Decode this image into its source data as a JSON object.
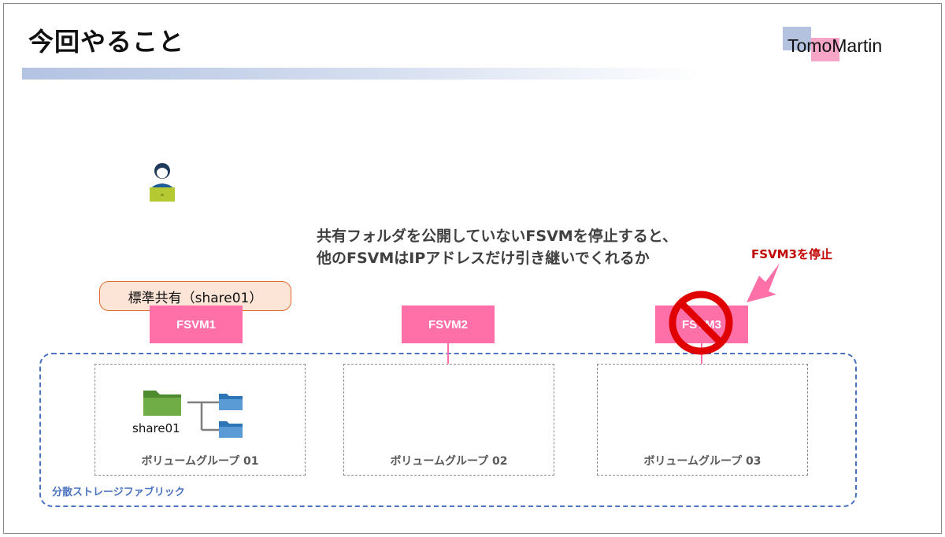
{
  "slide": {
    "title": "今回やること",
    "logo": "TomoMartin"
  },
  "question": {
    "line1": "共有フォルダを公開していないFSVMを停止すると、",
    "line2": "他のFSVMはIPアドレスだけ引き継いでくれるか"
  },
  "stop_label": "FSVM3を停止",
  "share_box": "標準共有（share01）",
  "fsvms": [
    "FSVM1",
    "FSVM2",
    "FSVM3"
  ],
  "volume_groups": [
    "ボリュームグループ 01",
    "ボリュームグループ 02",
    "ボリュームグループ 03"
  ],
  "fabric_label": "分散ストレージファブリック",
  "share_name": "share01",
  "colors": {
    "fsvm": "#ff6fa8",
    "fabric_border": "#4a72c0",
    "stop": "#c00000",
    "folder_main": "#70ad47",
    "folder_sub": "#4f9fdc"
  },
  "icons": [
    "user-laptop-icon",
    "folder-icon",
    "prohibit-icon",
    "arrow-icon"
  ]
}
